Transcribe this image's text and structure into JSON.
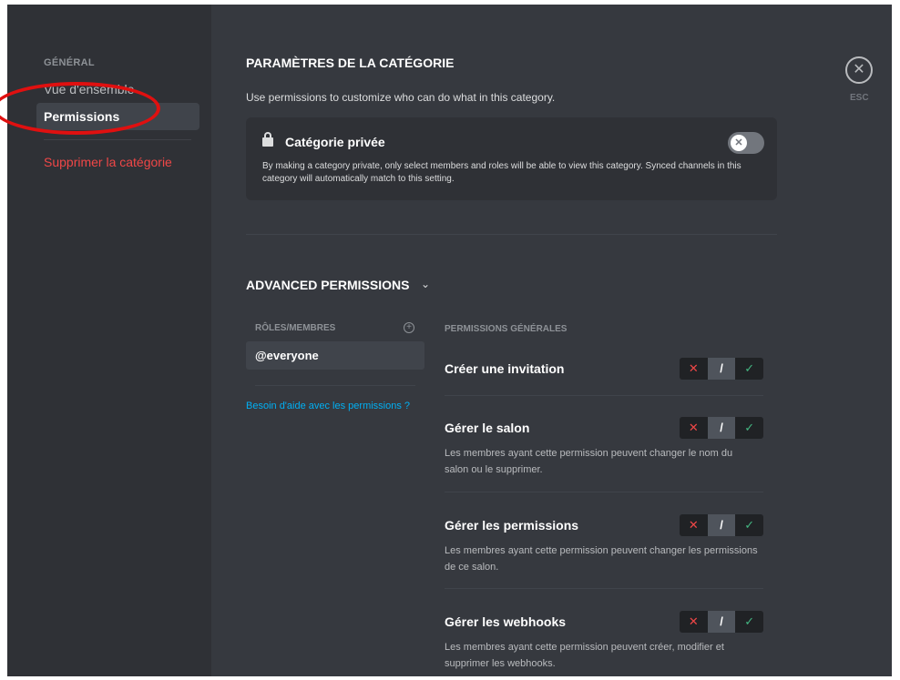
{
  "sidebar": {
    "header": "GÉNÉRAL",
    "items": [
      {
        "label": "Vue d'ensemble"
      },
      {
        "label": "Permissions"
      },
      {
        "label": "Supprimer la catégorie"
      }
    ]
  },
  "main": {
    "title": "PARAMÈTRES DE LA CATÉGORIE",
    "subtitle": "Use permissions to customize who can do what in this category.",
    "private_category": {
      "title": "Catégorie privée",
      "description": "By making a category private, only select members and roles will be able to view this category. Synced channels in this category will automatically match to this setting."
    },
    "advanced_title": "ADVANCED PERMISSIONS",
    "roles_header": "RÔLES/MEMBRES",
    "roles": [
      "@everyone"
    ],
    "help_link": "Besoin d'aide avec les permissions ?",
    "permissions_header": "PERMISSIONS GÉNÉRALES",
    "permissions": [
      {
        "name": "Créer une invitation",
        "description": ""
      },
      {
        "name": "Gérer le salon",
        "description": "Les membres ayant cette permission peuvent changer le nom du salon ou le supprimer."
      },
      {
        "name": "Gérer les permissions",
        "description": "Les membres ayant cette permission peuvent changer les permissions de ce salon."
      },
      {
        "name": "Gérer les webhooks",
        "description": "Les membres ayant cette permission peuvent créer, modifier et supprimer les webhooks."
      }
    ],
    "tri_state": {
      "deny": "✕",
      "pass": "/",
      "allow": "✓"
    }
  },
  "close": {
    "icon": "close-icon",
    "label": "ESC"
  },
  "colors": {
    "accent_link": "#00b0f4",
    "danger": "#f04747",
    "allow": "#43b581",
    "annotation": "#e01010"
  }
}
